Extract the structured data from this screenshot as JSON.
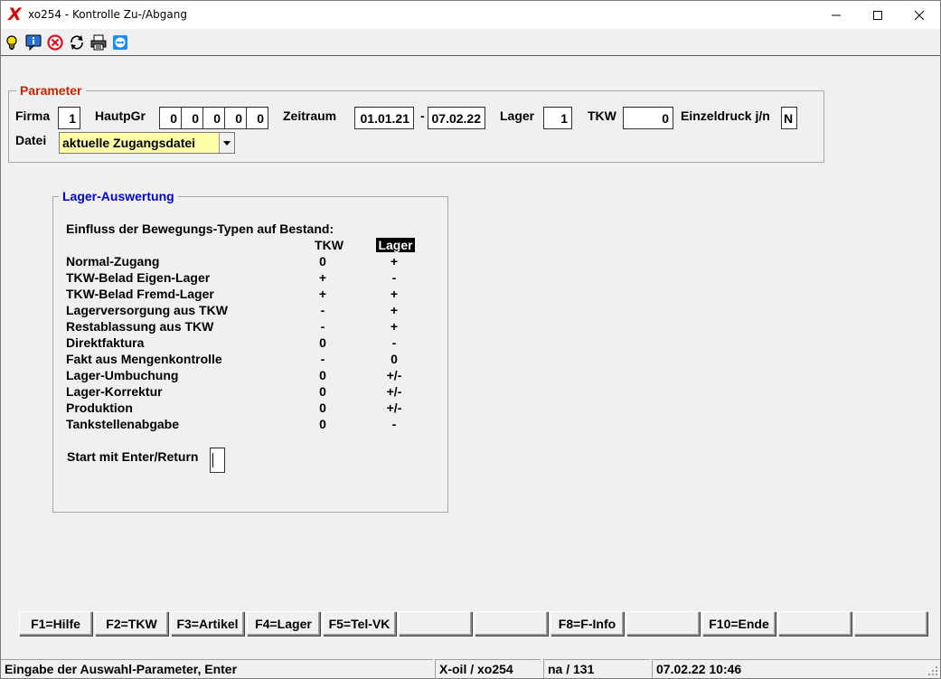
{
  "window": {
    "title": "xo254 - Kontrolle Zu-/Abgang",
    "logo": "X"
  },
  "toolbar": {
    "icons": [
      "lightbulb-icon",
      "info-chat-icon",
      "cancel-circle-icon",
      "refresh-icon",
      "printer-icon",
      "teamviewer-icon"
    ]
  },
  "parameter": {
    "legend": "Parameter",
    "legend_color": "#cc2200",
    "firma_label": "Firma",
    "firma_value": "1",
    "hauptgr_label": "HautpGr",
    "hauptgr_values": [
      "0",
      "0",
      "0",
      "0",
      "0"
    ],
    "zeitraum_label": "Zeitraum",
    "zeitraum_from": "01.01.21",
    "zeitraum_sep": "-",
    "zeitraum_to": "07.02.22",
    "lager_label": "Lager",
    "lager_value": "1",
    "tkw_label": "TKW",
    "tkw_value": "0",
    "einzeldruck_label": "Einzeldruck j/n",
    "einzeldruck_value": "N",
    "datei_label": "Datei",
    "datei_value": "aktuelle Zugangsdatei"
  },
  "auswertung": {
    "legend": "Lager-Auswertung",
    "legend_color": "#0000cc",
    "heading": "Einfluss der Bewegungs-Typen auf Bestand:",
    "col_tkw": "TKW",
    "col_lager": "Lager",
    "rows": [
      {
        "label": "Normal-Zugang",
        "tkw": "0",
        "lager": "+"
      },
      {
        "label": "TKW-Belad Eigen-Lager",
        "tkw": "+",
        "lager": "-"
      },
      {
        "label": "TKW-Belad Fremd-Lager",
        "tkw": "+",
        "lager": "+"
      },
      {
        "label": "Lagerversorgung aus TKW",
        "tkw": "-",
        "lager": "+"
      },
      {
        "label": "Restablassung aus TKW",
        "tkw": "-",
        "lager": "+"
      },
      {
        "label": "Direktfaktura",
        "tkw": "0",
        "lager": "-"
      },
      {
        "label": "Fakt aus Mengenkontrolle",
        "tkw": "-",
        "lager": "0"
      },
      {
        "label": "Lager-Umbuchung",
        "tkw": "0",
        "lager": "+/-"
      },
      {
        "label": "Lager-Korrektur",
        "tkw": "0",
        "lager": "+/-"
      },
      {
        "label": "Produktion",
        "tkw": "0",
        "lager": "+/-"
      },
      {
        "label": "Tankstellenabgabe",
        "tkw": "0",
        "lager": "-"
      }
    ],
    "start_label": "Start mit Enter/Return"
  },
  "fkeys": [
    "F1=Hilfe",
    "F2=TKW",
    "F3=Artikel",
    "F4=Lager",
    "F5=Tel-VK",
    "",
    "",
    "F8=F-Info",
    "",
    "F10=Ende",
    "",
    ""
  ],
  "status": {
    "message": "Eingabe der Auswahl-Parameter, Enter",
    "app": "X-oil / xo254",
    "user": "na / 131",
    "datetime": "07.02.22 10:46"
  }
}
